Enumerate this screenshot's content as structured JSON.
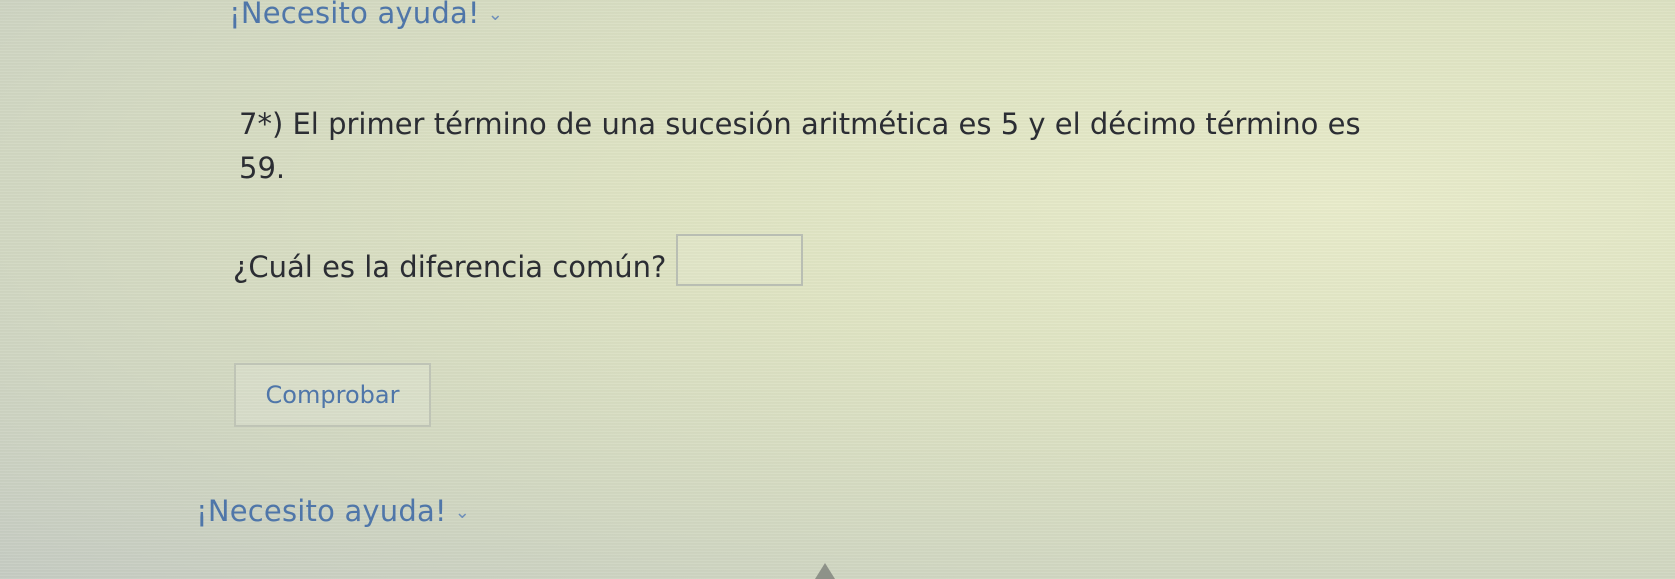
{
  "help_top": {
    "label": "¡Necesito ayuda!",
    "icon": "chevron-down-icon"
  },
  "question": {
    "text": "7*) El primer término de una sucesión aritmética es 5 y el décimo término es 59."
  },
  "prompt": {
    "label": "¿Cuál es la diferencia común?",
    "answer_value": ""
  },
  "check_button": {
    "label": "Comprobar"
  },
  "help_bottom": {
    "label": "¡Necesito ayuda!",
    "icon": "chevron-down-icon"
  },
  "colors": {
    "link": "#4f76a9",
    "text": "#2b2d33",
    "border": "#bfc4b6"
  }
}
